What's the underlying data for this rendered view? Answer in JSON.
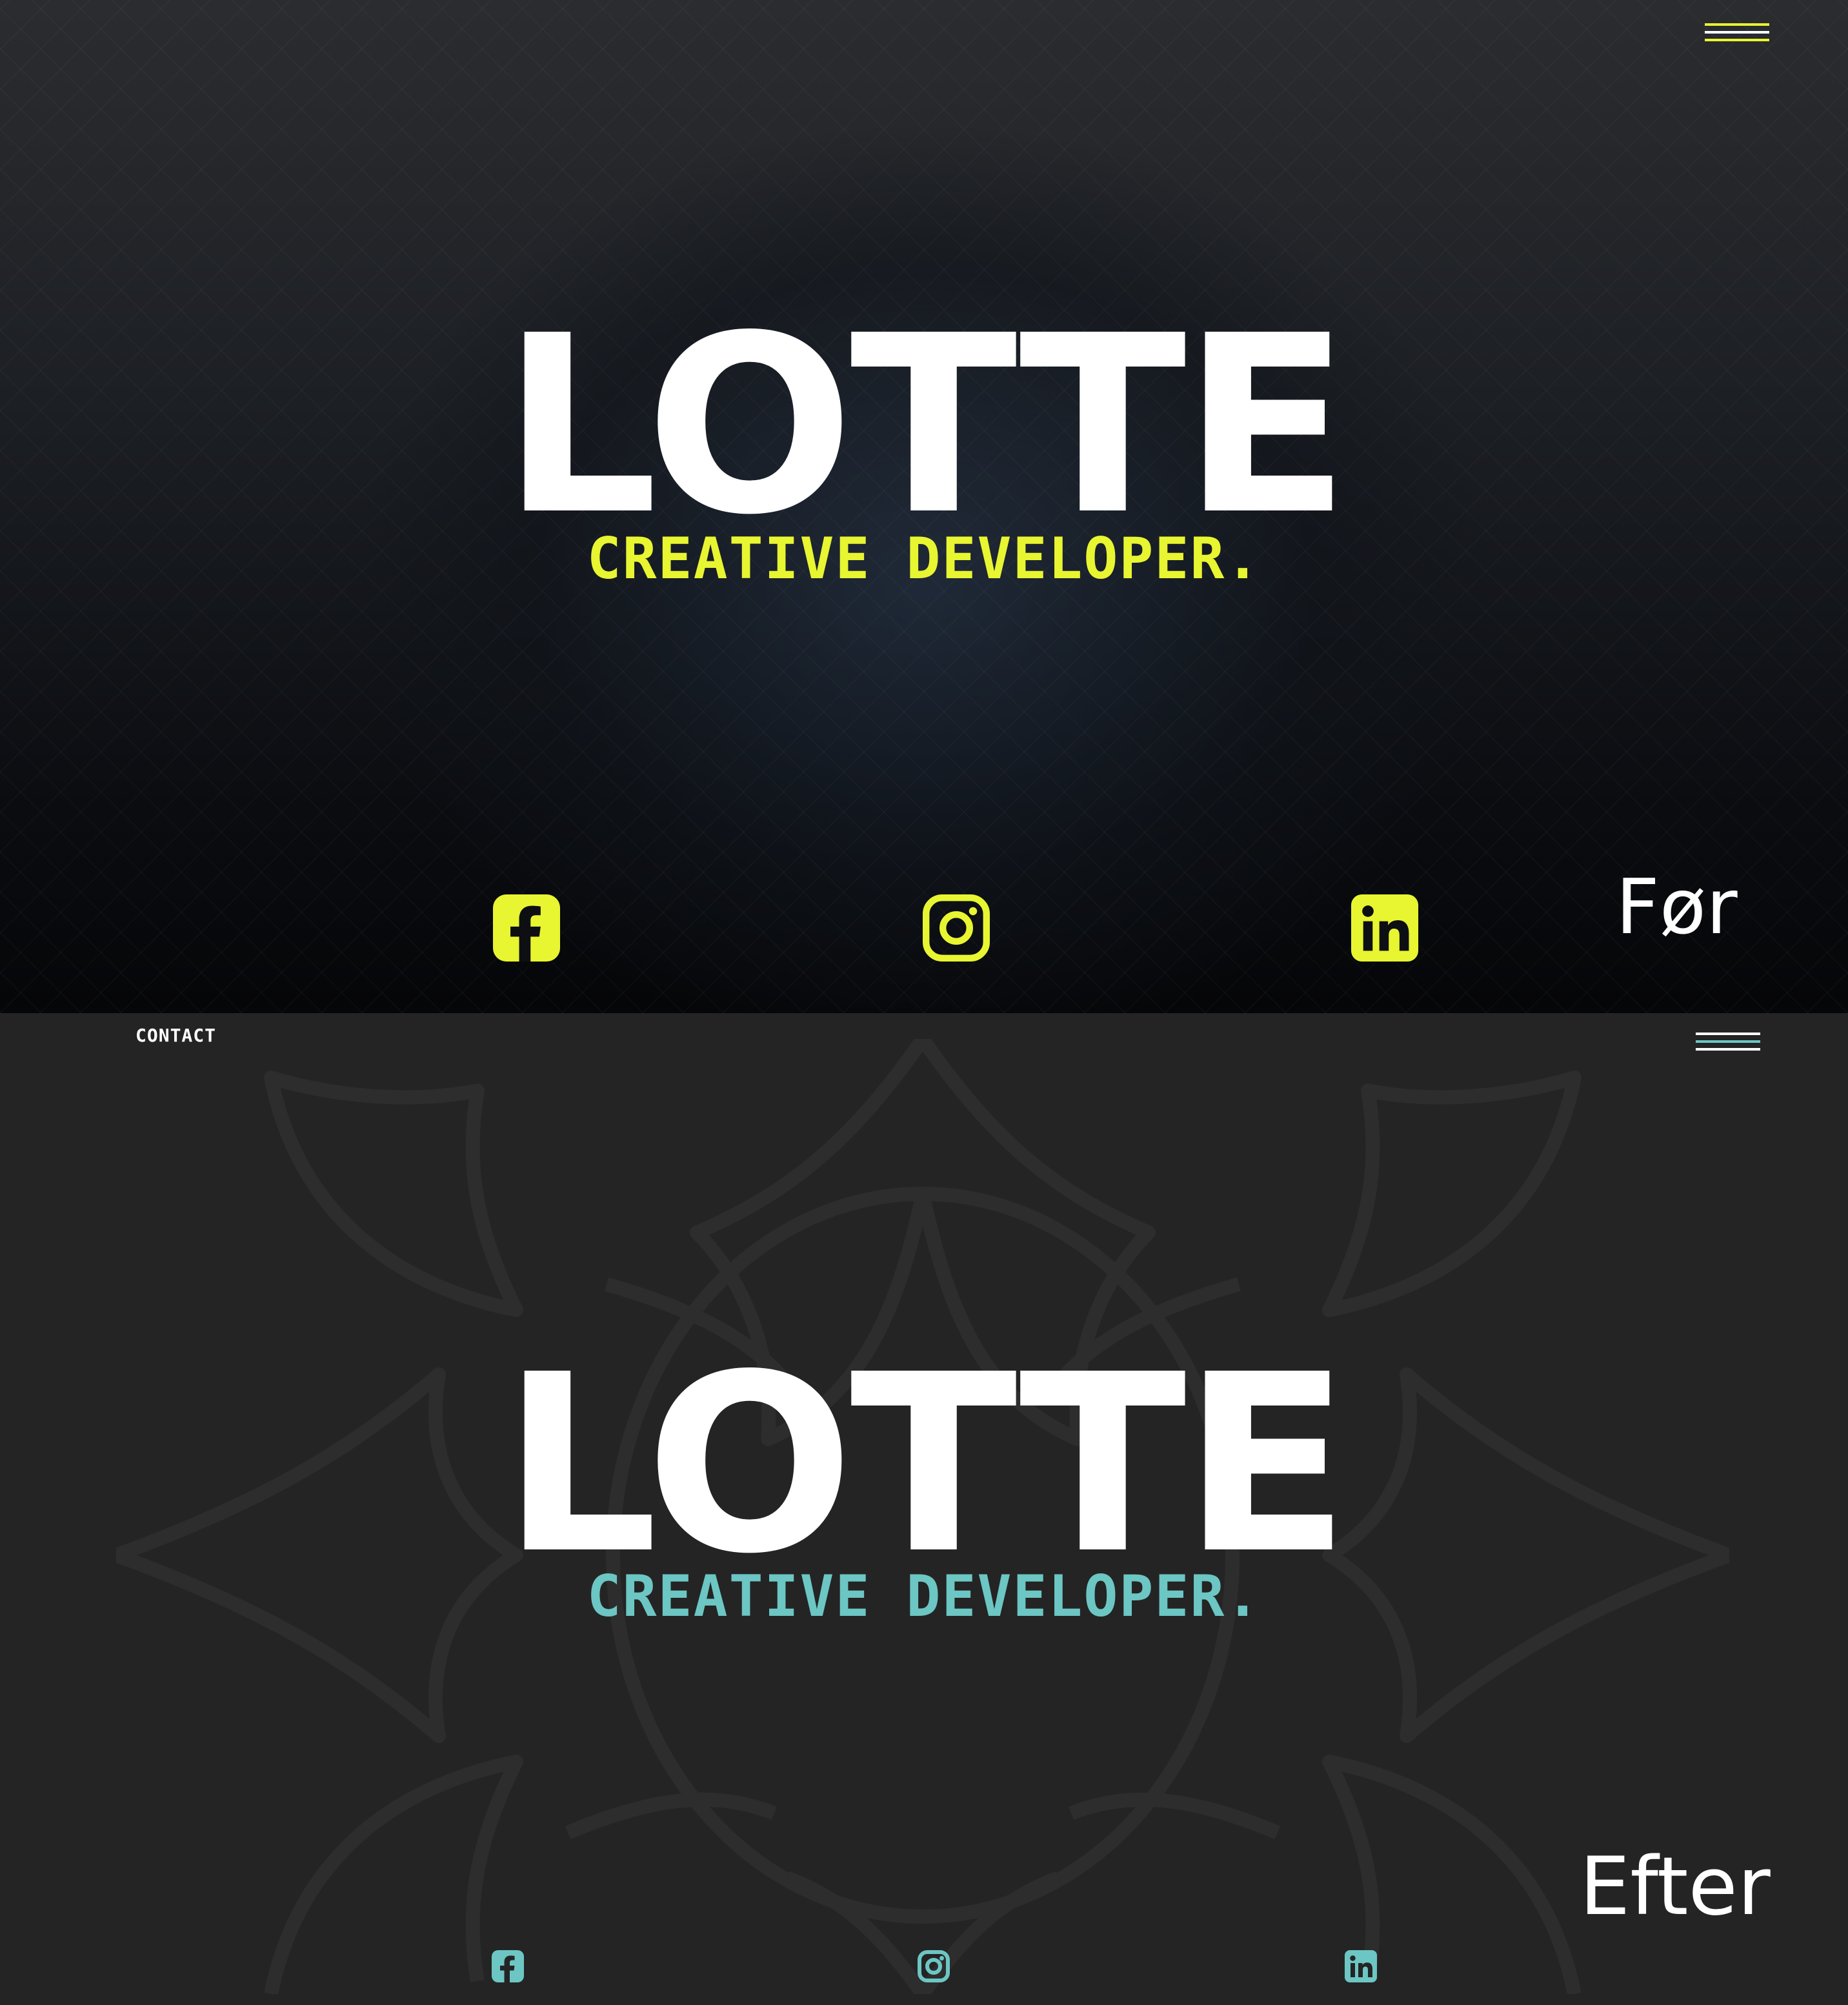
{
  "before": {
    "title": "LOTTE",
    "subtitle": "CREATIVE DEVELOPER.",
    "label": "Før",
    "accent_color": "#e8f531",
    "menu_icon": "hamburger-menu-icon",
    "social": [
      {
        "name": "facebook",
        "icon": "facebook-icon"
      },
      {
        "name": "instagram",
        "icon": "instagram-icon"
      },
      {
        "name": "linkedin",
        "icon": "linkedin-icon"
      }
    ]
  },
  "after": {
    "nav_contact": "CONTACT",
    "title": "LOTTE",
    "subtitle": "CREATIVE DEVELOPER.",
    "label": "Efter",
    "accent_color": "#6cc6c3",
    "menu_icon": "hamburger-menu-icon",
    "background_decoration": "mandala-pattern",
    "social": [
      {
        "name": "facebook",
        "icon": "facebook-icon"
      },
      {
        "name": "instagram",
        "icon": "instagram-icon"
      },
      {
        "name": "linkedin",
        "icon": "linkedin-icon"
      }
    ]
  }
}
